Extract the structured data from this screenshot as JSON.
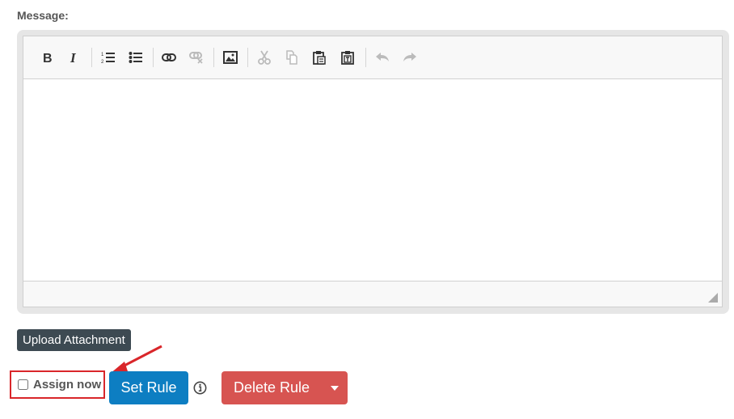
{
  "message_label": "Message:",
  "toolbar": {
    "buttons": [
      {
        "name": "bold-button",
        "icon": "bold-icon",
        "enabled": true
      },
      {
        "name": "italic-button",
        "icon": "italic-icon",
        "enabled": true
      },
      {
        "name": "numbered-list-button",
        "icon": "numbered-list-icon",
        "enabled": true
      },
      {
        "name": "bulleted-list-button",
        "icon": "bulleted-list-icon",
        "enabled": true
      },
      {
        "name": "link-button",
        "icon": "link-icon",
        "enabled": true
      },
      {
        "name": "unlink-button",
        "icon": "unlink-icon",
        "enabled": false
      },
      {
        "name": "image-button",
        "icon": "image-icon",
        "enabled": true
      },
      {
        "name": "cut-button",
        "icon": "scissors-icon",
        "enabled": false
      },
      {
        "name": "copy-button",
        "icon": "copy-icon",
        "enabled": false
      },
      {
        "name": "paste-button",
        "icon": "paste-icon",
        "enabled": true
      },
      {
        "name": "paste-text-button",
        "icon": "paste-text-icon",
        "enabled": true
      },
      {
        "name": "undo-button",
        "icon": "undo-icon",
        "enabled": false
      },
      {
        "name": "redo-button",
        "icon": "redo-icon",
        "enabled": false
      }
    ]
  },
  "editor": {
    "content": ""
  },
  "upload_attachment_label": "Upload Attachment",
  "assign_now": {
    "label": "Assign now",
    "checked": false
  },
  "set_rule_label": "Set Rule",
  "delete_rule_label": "Delete Rule",
  "colors": {
    "primary": "#0d7ec2",
    "danger": "#d75451",
    "dark_button": "#3d4a52",
    "highlight": "#d9262a"
  }
}
